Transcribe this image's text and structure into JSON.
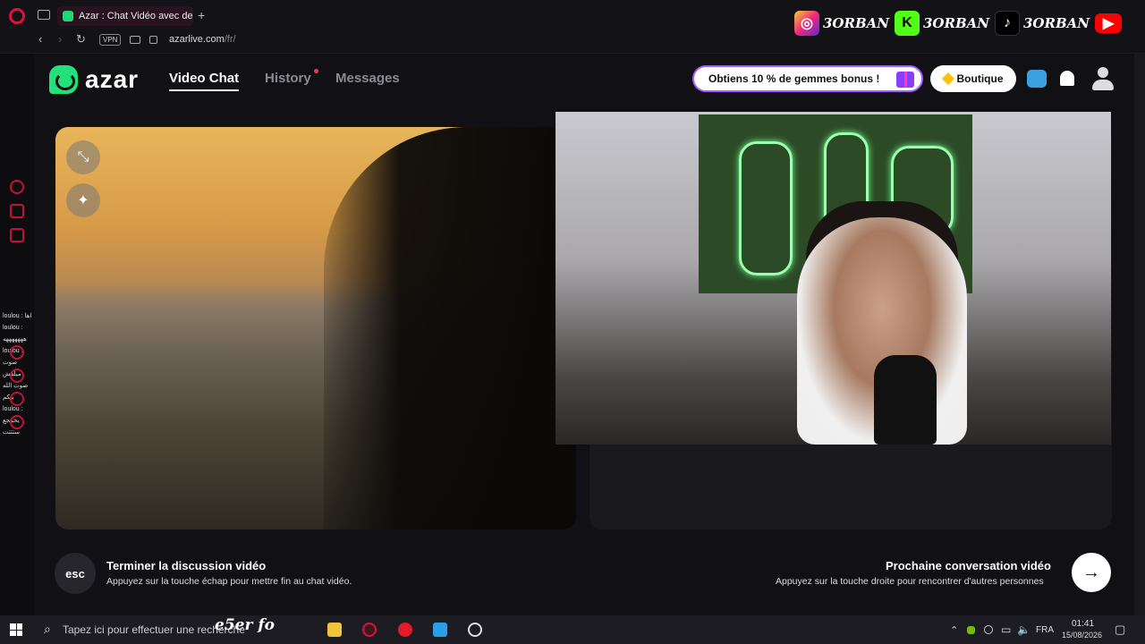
{
  "browser": {
    "tab_title": "Azar : Chat Vidéo avec de n",
    "new_tab": "+",
    "vpn": "VPN",
    "url_main": "azarlive.com",
    "url_path": "/fr/"
  },
  "overlay": {
    "social_name": "3ORBAN"
  },
  "sidebar_chat": [
    "loulou : اها",
    "loulou : هههههههه",
    "loulou : صوت ميلقش صوت الله بيكم",
    "loulou : يحمجع ستتتت"
  ],
  "app": {
    "logo_text": "azar",
    "nav": {
      "video_chat": "Video Chat",
      "history": "History",
      "messages": "Messages"
    },
    "promo_label": "Obtiens 10 % de gemmes bonus !",
    "shop_label": "Boutique"
  },
  "footer": {
    "esc_key": "esc",
    "end_title": "Terminer la discussion vidéo",
    "end_sub": "Appuyez sur la touche échap pour mettre fin au chat vidéo.",
    "next_title": "Prochaine conversation vidéo",
    "next_sub": "Appuyez sur la touche droite pour rencontrer d'autres personnes",
    "next_arrow": "→"
  },
  "taskbar": {
    "search_placeholder": "Tapez ici pour effectuer une recherche",
    "overlay_text": "e5er  fo",
    "language": "FRA",
    "time": "01:41",
    "date": "15/08/2026"
  },
  "colors": {
    "accent_green": "#22e07a",
    "opera_red": "#e0103a",
    "promo_border": "#a45cff"
  }
}
